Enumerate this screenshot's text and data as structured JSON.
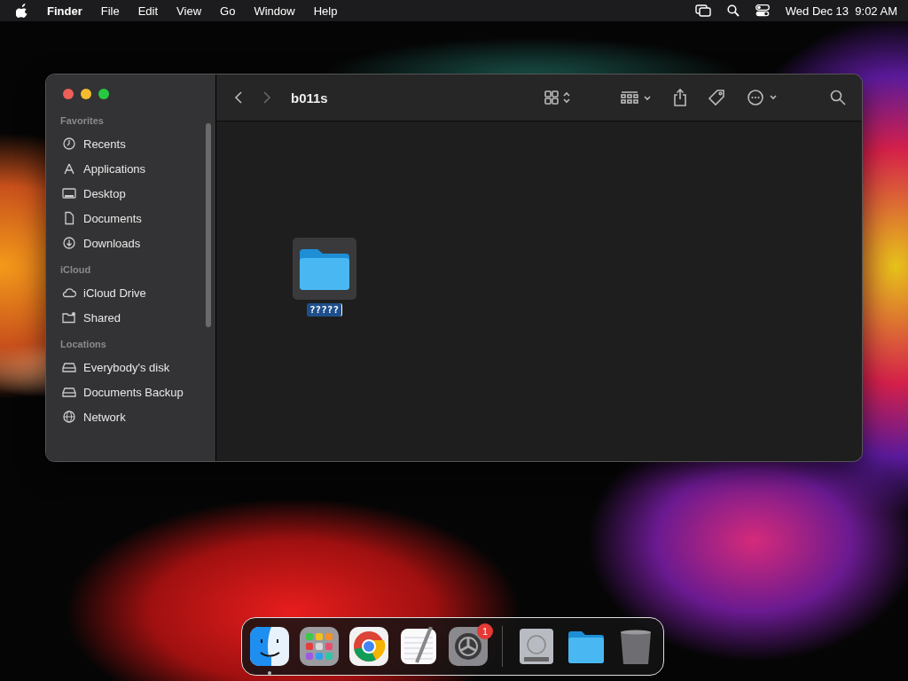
{
  "menu_bar": {
    "app": "Finder",
    "menus": [
      "File",
      "Edit",
      "View",
      "Go",
      "Window",
      "Help"
    ],
    "clock": "Wed Dec 13  9:02 AM"
  },
  "window": {
    "title": "b011s",
    "sidebar": [
      {
        "heading": "Favorites",
        "items": [
          {
            "label": "Recents",
            "kind": "clock"
          },
          {
            "label": "Applications",
            "kind": "apps"
          },
          {
            "label": "Desktop",
            "kind": "desktop"
          },
          {
            "label": "Documents",
            "kind": "document"
          },
          {
            "label": "Downloads",
            "kind": "download"
          }
        ]
      },
      {
        "heading": "iCloud",
        "items": [
          {
            "label": "iCloud Drive",
            "kind": "cloud"
          },
          {
            "label": "Shared",
            "kind": "shared"
          }
        ]
      },
      {
        "heading": "Locations",
        "items": [
          {
            "label": "Everybody's disk",
            "kind": "disk"
          },
          {
            "label": "Documents Backup",
            "kind": "disk"
          },
          {
            "label": "Network",
            "kind": "network"
          }
        ]
      }
    ],
    "files": [
      {
        "name": "?????",
        "selected": true
      }
    ]
  },
  "dock": [
    {
      "kind": "finder",
      "running": true
    },
    {
      "kind": "launchpad",
      "running": false
    },
    {
      "kind": "chrome",
      "running": false
    },
    {
      "kind": "textedit",
      "running": false
    },
    {
      "kind": "settings",
      "running": false,
      "badge": "1"
    },
    {
      "kind": "separator"
    },
    {
      "kind": "drive",
      "running": false
    },
    {
      "kind": "folder",
      "running": false
    },
    {
      "kind": "trash",
      "running": false
    }
  ]
}
